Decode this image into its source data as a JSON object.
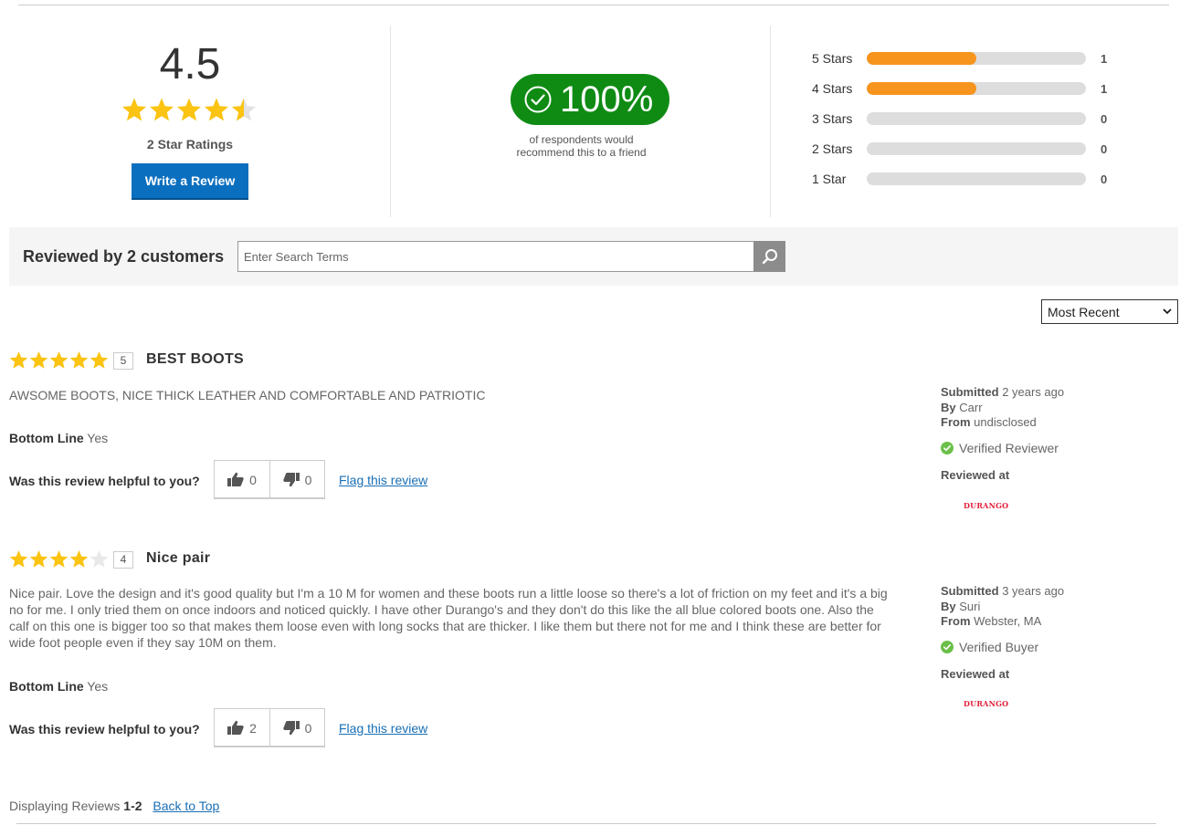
{
  "summary": {
    "average": "4.5",
    "average_value": 4.5,
    "rating_count_label": "2 Star Ratings",
    "write_review_label": "Write a Review",
    "recommend_percent": "100%",
    "recommend_text_1": "of respondents would",
    "recommend_text_2": "recommend this to a friend",
    "histogram": [
      {
        "label": "5 Stars",
        "count": "1",
        "fraction": 0.5
      },
      {
        "label": "4 Stars",
        "count": "1",
        "fraction": 0.5
      },
      {
        "label": "3 Stars",
        "count": "0",
        "fraction": 0
      },
      {
        "label": "2 Stars",
        "count": "0",
        "fraction": 0
      },
      {
        "label": "1 Star",
        "count": "0",
        "fraction": 0
      }
    ]
  },
  "search": {
    "title": "Reviewed by 2 customers",
    "placeholder": "Enter Search Terms"
  },
  "sort": {
    "selected": "Most Recent"
  },
  "reviews": [
    {
      "rating": "5",
      "title": "BEST BOOTS",
      "body": "AWSOME BOOTS, NICE THICK LEATHER AND COMFORTABLE AND PATRIOTIC",
      "bottom_line_label": "Bottom Line",
      "bottom_line_value": "Yes",
      "helpful_label": "Was this review helpful to you?",
      "up_votes": "0",
      "down_votes": "0",
      "flag_label": "Flag this review",
      "submitted_label": "Submitted",
      "submitted_value": "2 years ago",
      "by_label": "By",
      "by_value": "Carr",
      "from_label": "From",
      "from_value": "undisclosed",
      "badge": "Verified Reviewer",
      "reviewed_at_label": "Reviewed at",
      "brand": "DURANGO"
    },
    {
      "rating": "4",
      "title": "Nice pair",
      "body": "Nice pair. Love the design and it's good quality but I'm a 10 M for women and these boots run a little loose so there's a lot of friction on my feet and it's a big no for me. I only tried them on once indoors and noticed quickly. I have other Durango's and they don't do this like the all blue colored boots one. Also the calf on this one is bigger too so that makes them loose even with long socks that are thicker. I like them but there not for me and I think these are better for wide foot people even if they say 10M on them.",
      "bottom_line_label": "Bottom Line",
      "bottom_line_value": "Yes",
      "helpful_label": "Was this review helpful to you?",
      "up_votes": "2",
      "down_votes": "0",
      "flag_label": "Flag this review",
      "submitted_label": "Submitted",
      "submitted_value": "3 years ago",
      "by_label": "By",
      "by_value": "Suri",
      "from_label": "From",
      "from_value": "Webster, MA",
      "badge": "Verified Buyer",
      "reviewed_at_label": "Reviewed at",
      "brand": "DURANGO"
    }
  ],
  "footer": {
    "displaying_label": "Displaying Reviews",
    "range": "1-2",
    "back_to_top": "Back to Top"
  },
  "colors": {
    "star": "#fbc312",
    "star_empty": "#e2e2e2",
    "bar_fill": "#f7941d",
    "recommend_green": "#0f8b14",
    "verified_green": "#6cc04a",
    "button_blue": "#0b6fbf",
    "link_blue": "#1a6fb5"
  }
}
